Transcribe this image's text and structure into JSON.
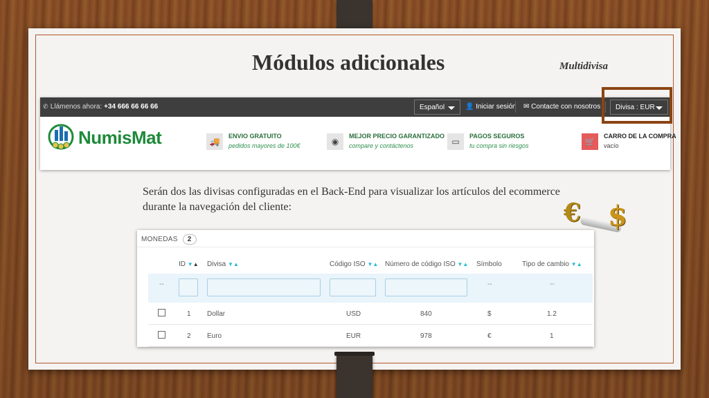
{
  "slide": {
    "title": "Módulos adicionales",
    "subtitle": "Multidivisa",
    "body": "Serán dos las divisas configuradas en el Back-End para visualizar los artículos del ecommerce durante la navegación del cliente:"
  },
  "shop": {
    "call_label": "Llámenos ahora:",
    "phone": "+34 666 66 66 66",
    "language": "Español",
    "login": "Iniciar sesión",
    "contact": "Contacte con nosotros",
    "currency": "Divisa : EUR",
    "logo": "NumisMat",
    "features": [
      {
        "title": "ENVIO GRATUITO",
        "sub": "pedidos mayores de 100€",
        "icon": "truck-icon"
      },
      {
        "title": "MEJOR PRECIO GARANTIZADO",
        "sub": "compare y contáctenos",
        "icon": "globe-icon"
      },
      {
        "title": "PAGOS SEGUROS",
        "sub": "tu compra sin riesgos",
        "icon": "credit-card-icon"
      },
      {
        "title": "CARRO DE LA COMPRA",
        "sub": "vacío",
        "icon": "cart-icon"
      }
    ],
    "colors": {
      "topbar": "#3e3e3e",
      "brand_green": "#1e8a3a",
      "cart_red": "#e55a5a",
      "highlight": "#8b4513"
    }
  },
  "currencies_table": {
    "heading": "MONEDAS",
    "count": "2",
    "columns": [
      "ID",
      "Divisa",
      "Código ISO",
      "Número de código ISO",
      "Símbolo",
      "Tipo de cambio"
    ],
    "filter_placeholder": "--",
    "rows": [
      {
        "id": "1",
        "name": "Dollar",
        "iso": "USD",
        "iso_num": "840",
        "symbol": "$",
        "rate": "1.2"
      },
      {
        "id": "2",
        "name": "Euro",
        "iso": "EUR",
        "iso_num": "978",
        "symbol": "€",
        "rate": "1"
      }
    ]
  },
  "decor": {
    "euro_symbol": "€",
    "dollar_symbol": "$"
  }
}
